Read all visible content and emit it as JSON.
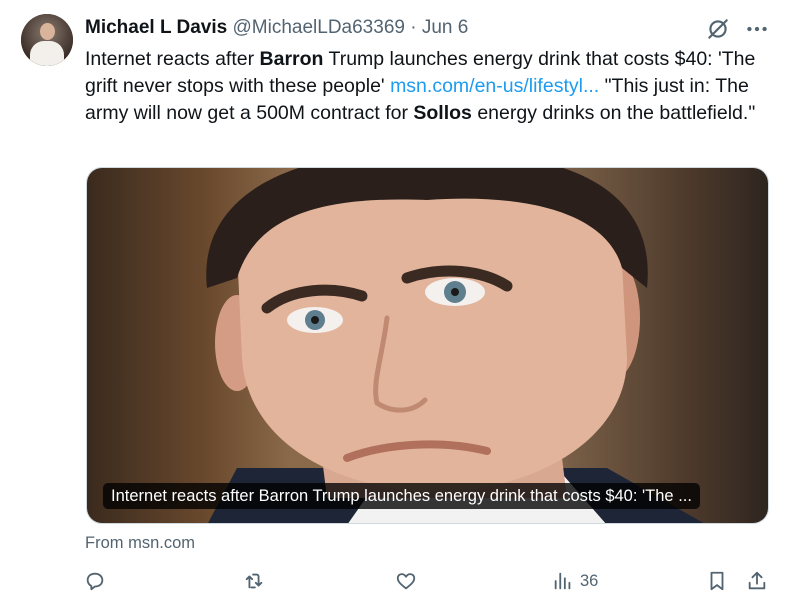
{
  "author": {
    "name": "Michael L Davis",
    "handle": "@MichaelLDa63369",
    "separator": "·",
    "date": "Jun 6"
  },
  "tweet": {
    "text_1": "Internet reacts after ",
    "bold_1": "Barron",
    "text_2": " Trump launches energy drink that costs $40: 'The grift never stops with these people' ",
    "link": "msn.com/en-us/lifestyl...",
    "text_3": " \"This just in: The army will now get a 500M contract for ",
    "bold_2": "Sollos",
    "text_4": " energy drinks on the battlefield.\""
  },
  "card": {
    "caption": "Internet reacts after Barron Trump launches energy drink that costs $40: 'The ...",
    "source": "From msn.com"
  },
  "actions": {
    "views_count": "36"
  },
  "icons": {
    "grok": "grok-icon",
    "more": "more-icon",
    "reply": "reply-icon",
    "retweet": "retweet-icon",
    "like": "heart-icon",
    "views": "views-icon",
    "bookmark": "bookmark-icon",
    "share": "share-icon"
  },
  "colors": {
    "link": "#1d9bf0",
    "secondary_text": "#536471",
    "primary_text": "#0f1419"
  }
}
